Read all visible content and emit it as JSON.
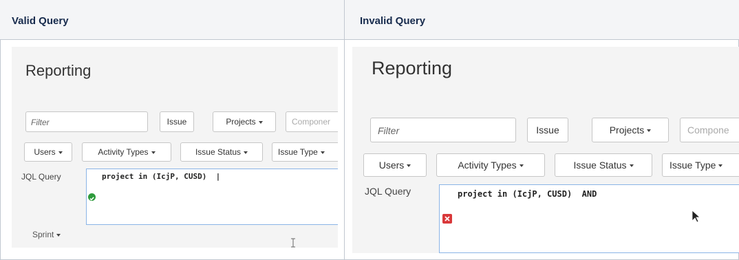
{
  "headers": {
    "valid": "Valid Query",
    "invalid": "Invalid Query"
  },
  "reporting": {
    "title": "Reporting",
    "filter_placeholder": "Filter",
    "issue_button": "Issue",
    "projects_button": "Projects",
    "components_button_left": "Componer",
    "components_button_right": "Compone",
    "users_button": "Users",
    "activity_types_button": "Activity Types",
    "issue_status_button": "Issue Status",
    "issue_type_button": "Issue Type",
    "jql_label": "JQL Query",
    "sprint_button": "Sprint"
  },
  "valid_query": {
    "text": "project in (IcjP, CUSD)  |",
    "status": "valid",
    "status_icon": "check-circle-icon",
    "status_color": "#2e9b3c"
  },
  "invalid_query": {
    "text": "project in (IcjP, CUSD)  AND",
    "status": "invalid",
    "status_icon": "error-x-icon",
    "status_color": "#d9383a"
  }
}
